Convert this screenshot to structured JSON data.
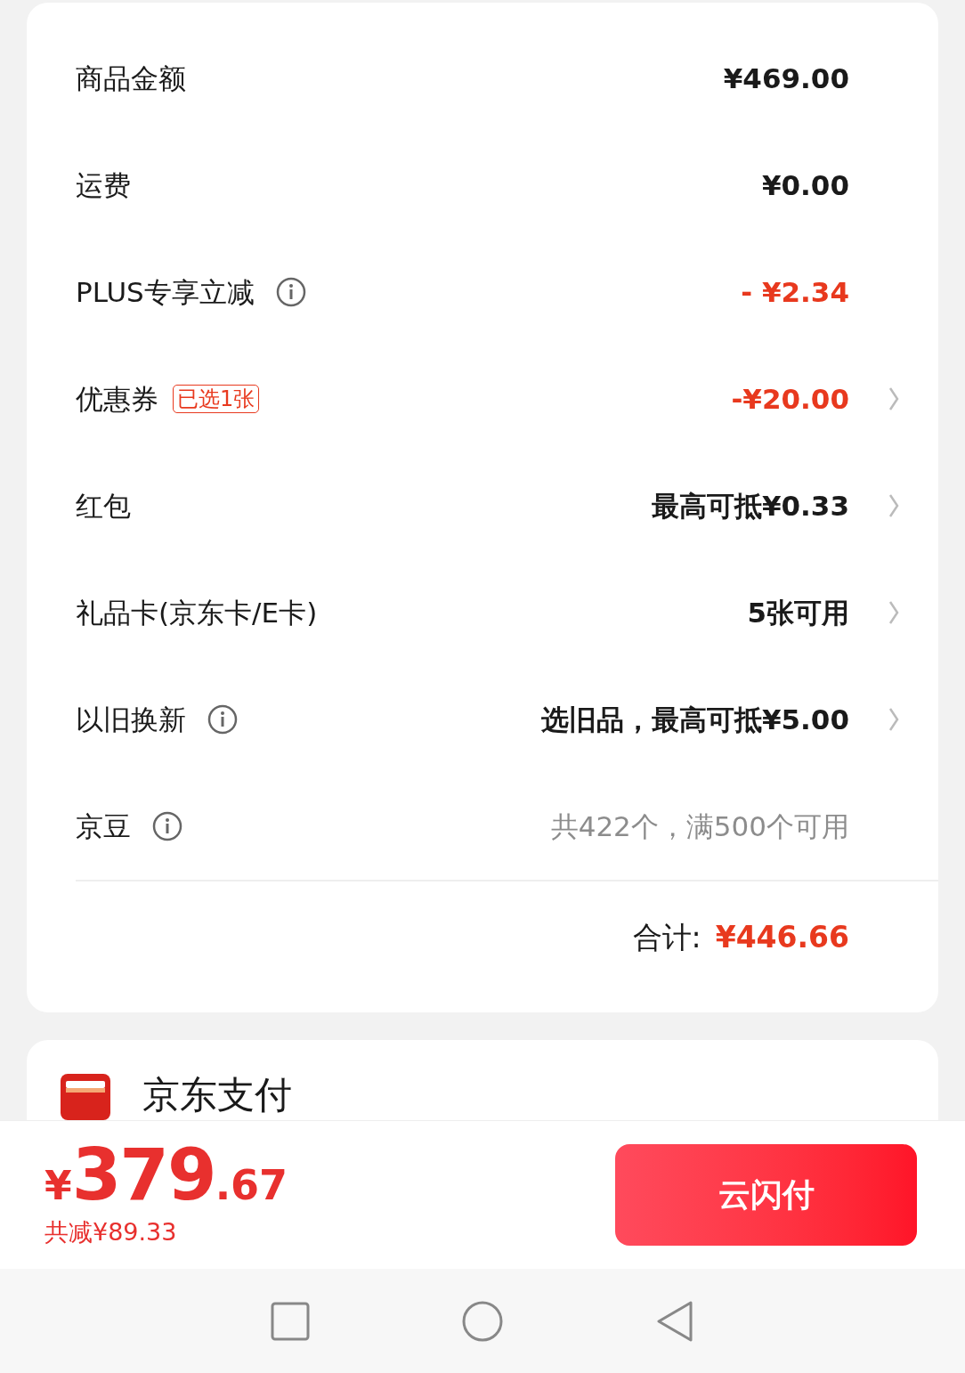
{
  "rows": [
    {
      "label": "商品金额",
      "info": false,
      "value": "¥469.00",
      "kind": "amount",
      "chevron": false
    },
    {
      "label": "运费",
      "info": false,
      "value": "¥0.00",
      "kind": "amount",
      "chevron": false
    },
    {
      "label": "PLUS专享立减",
      "info": true,
      "value": "- ¥2.34",
      "kind": "discount",
      "chevron": false
    },
    {
      "label": "优惠券",
      "info": false,
      "badge": "已选1张",
      "value": "-¥20.00",
      "kind": "discount",
      "chevron": true
    },
    {
      "label": "红包",
      "info": false,
      "value": "最高可抵¥0.33",
      "kind": "amount",
      "chevron": true
    },
    {
      "label": "礼品卡(京东卡/E卡)",
      "info": false,
      "value": "5张可用",
      "kind": "amount",
      "chevron": true
    },
    {
      "label": "以旧换新",
      "info": true,
      "value": "选旧品，最高可抵¥5.00",
      "kind": "amount",
      "chevron": true
    },
    {
      "label": "京豆",
      "info": true,
      "value": "共422个，满500个可用",
      "kind": "hint",
      "chevron": false
    }
  ],
  "total": {
    "label": "合计:",
    "value": "¥446.66"
  },
  "payment": {
    "title": "京东支付"
  },
  "bottom_bar": {
    "currency": "¥",
    "price_int": "379",
    "price_dec": ".67",
    "saved": "共减¥89.33",
    "button": "云闪付"
  }
}
